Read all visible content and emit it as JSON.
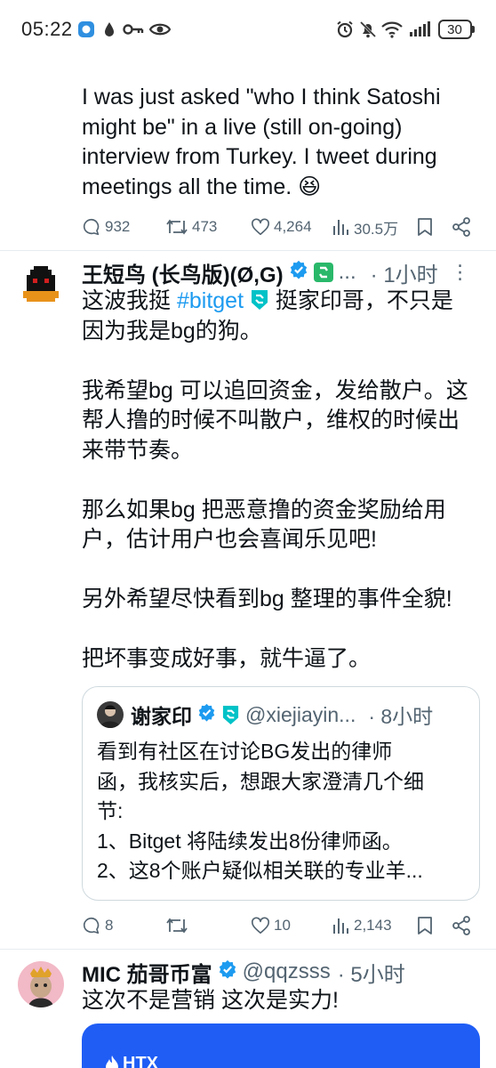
{
  "status": {
    "time": "05:22",
    "battery": "30"
  },
  "tweet1": {
    "lines": [
      "I was just asked \"who I think Satoshi",
      "might be\" in a live (still on-going)",
      "interview from Turkey. I tweet during",
      "meetings all the time. 😆"
    ],
    "replies": "932",
    "retweets": "473",
    "likes": "4,264",
    "views": "30.5万"
  },
  "tweet2": {
    "name": "王短鸟 (长鸟版)(Ø,G)",
    "handle_truncated": "...",
    "time": "· 1小时",
    "line1_pre": "这波我挺 ",
    "hashtag": "#bitget",
    "line1_post": " 挺家印哥，不只是",
    "lines": [
      "因为我是bg的狗。",
      "",
      "我希望bg 可以追回资金，发给散户。这",
      "帮人撸的时候不叫散户，维权的时候出",
      "来带节奏。",
      "",
      "那么如果bg 把恶意撸的资金奖励给用",
      "户，估计用户也会喜闻乐见吧!",
      "",
      "另外希望尽快看到bg 整理的事件全貌!",
      "",
      "把坏事变成好事，就牛逼了。"
    ],
    "replies": "8",
    "retweets": "",
    "likes": "10",
    "views": "2,143"
  },
  "quote": {
    "name": "谢家印",
    "handle": "@xiejiayin...",
    "time": "· 8小时",
    "lines": [
      "看到有社区在讨论BG发出的律师",
      "函，我核实后，想跟大家澄清几个细",
      "节:",
      "1、Bitget 将陆续发出8份律师函。",
      "2、这8个账户疑似相关联的专业羊..."
    ]
  },
  "tweet3": {
    "name": "MIC 茄哥币富",
    "handle": "@qqzsss",
    "time": "· 5小时",
    "text": "这次不是营销 这次是实力!",
    "card_label": "HTX"
  },
  "colors": {
    "verified": "#1d9bf0",
    "bitget": "#00c2c7",
    "muted": "#536471",
    "card": "#1f5df5"
  }
}
